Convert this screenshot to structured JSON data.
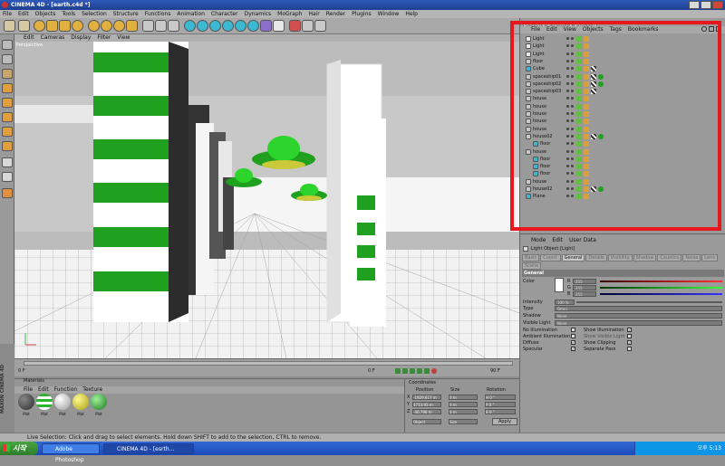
{
  "window": {
    "title": "CINEMA 4D - [earth.c4d *]"
  },
  "menubar": [
    "File",
    "Edit",
    "Objects",
    "Tools",
    "Selection",
    "Structure",
    "Functions",
    "Animation",
    "Character",
    "Dynamics",
    "MoGraph",
    "Hair",
    "Render",
    "Plugins",
    "Window",
    "Help"
  ],
  "viewport": {
    "menu": [
      "Edit",
      "Cameras",
      "Display",
      "Filter",
      "View"
    ],
    "label": "Perspective"
  },
  "object_manager": {
    "tabs": [
      "Objects",
      "Structure",
      "Browser"
    ],
    "menu": [
      "File",
      "Edit",
      "View",
      "Objects",
      "Tags",
      "Bookmarks"
    ],
    "objects": [
      {
        "name": "Light",
        "indent": 0,
        "type": "light"
      },
      {
        "name": "Light",
        "indent": 0,
        "type": "light"
      },
      {
        "name": "Light",
        "indent": 0,
        "type": "light"
      },
      {
        "name": "floor",
        "indent": 0,
        "type": "null"
      },
      {
        "name": "Cube",
        "indent": 0,
        "type": "cube"
      },
      {
        "name": "spaceship01",
        "indent": 0,
        "type": "null"
      },
      {
        "name": "spaceship02",
        "indent": 0,
        "type": "null"
      },
      {
        "name": "spaceship03",
        "indent": 0,
        "type": "null"
      },
      {
        "name": "house",
        "indent": 0,
        "type": "null"
      },
      {
        "name": "house",
        "indent": 0,
        "type": "null"
      },
      {
        "name": "house",
        "indent": 0,
        "type": "null"
      },
      {
        "name": "house",
        "indent": 0,
        "type": "null"
      },
      {
        "name": "house",
        "indent": 0,
        "type": "null"
      },
      {
        "name": "house02",
        "indent": 0,
        "type": "null"
      },
      {
        "name": "floor",
        "indent": 1,
        "type": "poly"
      },
      {
        "name": "house",
        "indent": 0,
        "type": "null"
      },
      {
        "name": "floor",
        "indent": 1,
        "type": "poly"
      },
      {
        "name": "floor",
        "indent": 1,
        "type": "poly"
      },
      {
        "name": "floor",
        "indent": 1,
        "type": "poly"
      },
      {
        "name": "house",
        "indent": 0,
        "type": "null"
      },
      {
        "name": "house02",
        "indent": 0,
        "type": "null"
      },
      {
        "name": "Plane",
        "indent": 0,
        "type": "poly"
      }
    ]
  },
  "attribute_manager": {
    "menu": [
      "Mode",
      "Edit",
      "User Data"
    ],
    "title": "Light Object [Light]",
    "tabs": [
      "Basic",
      "Coord.",
      "General",
      "Details",
      "Visibility",
      "Shadow",
      "Caustics",
      "Noise",
      "Lens",
      "Scene"
    ],
    "active_tab": "General",
    "section": "General",
    "color_label": "Color",
    "rgb": [
      {
        "ch": "R",
        "val": "255"
      },
      {
        "ch": "G",
        "val": "255"
      },
      {
        "ch": "B",
        "val": "255"
      }
    ],
    "intensity_label": "Intensity",
    "intensity_val": "100 %",
    "type_label": "Type",
    "type_val": "Omni",
    "shadow_label": "Shadow",
    "shadow_val": "None",
    "visible_light_label": "Visible Light",
    "visible_light_val": "None",
    "checks_left": [
      {
        "label": "No Illumination",
        "checked": false
      },
      {
        "label": "Ambient Illumination",
        "checked": false
      },
      {
        "label": "Diffuse",
        "checked": true
      },
      {
        "label": "Specular",
        "checked": true
      }
    ],
    "checks_right": [
      {
        "label": "Show Illumination",
        "checked": true
      },
      {
        "label": "Show Visible Light",
        "checked": false
      },
      {
        "label": "Show Clipping",
        "checked": true
      },
      {
        "label": "Separate Pass",
        "checked": false
      }
    ]
  },
  "timeline": {
    "start": "0 F",
    "end": "90 F",
    "current": "0 F"
  },
  "material_manager": {
    "title": "Materials",
    "menu": [
      "File",
      "Edit",
      "Function",
      "Texture"
    ],
    "materials": [
      {
        "name": "Mat",
        "color": "#2a2a2a"
      },
      {
        "name": "Mat",
        "color": "#2db52d"
      },
      {
        "name": "Mat",
        "color": "#ffffff"
      },
      {
        "name": "Mat",
        "color": "#d8d020"
      },
      {
        "name": "Mat",
        "color": "#2db52d"
      }
    ]
  },
  "coordinates": {
    "title": "Coordinates",
    "headers": [
      "Position",
      "Size",
      "Rotation"
    ],
    "rows": [
      {
        "axis": "X",
        "pos": "-1929.617 m",
        "size": "0 m",
        "rot": "H 0 °"
      },
      {
        "axis": "Y",
        "pos": "4713.93 m",
        "size": "0 m",
        "rot": "P 0 °"
      },
      {
        "axis": "Z",
        "pos": "-40.796 m",
        "size": "0 m",
        "rot": "B 0 °"
      }
    ],
    "mode1": "Object",
    "mode2": "Size",
    "apply_label": "Apply"
  },
  "status_text": "Live Selection: Click and drag to select elements. Hold down SHIFT to add to the selection, CTRL to remove.",
  "taskbar": {
    "start_label": "시작",
    "tasks": [
      {
        "label": "Adobe Photoshop"
      },
      {
        "label": "CINEMA 4D - [esrth..."
      }
    ],
    "clock": "오후 5:13"
  },
  "colors": {
    "highlight": "#e8161d",
    "green": "#1fa11f"
  }
}
